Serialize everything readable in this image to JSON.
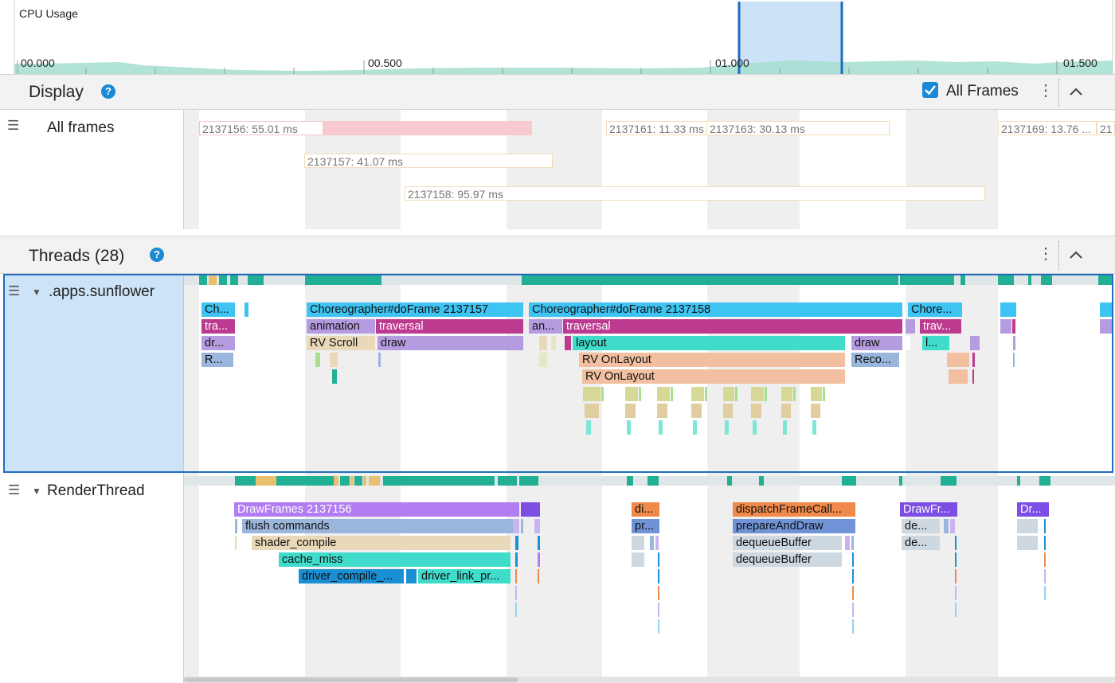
{
  "cpu": {
    "title": "CPU Usage",
    "ticks": [
      "00.000",
      "00.500",
      "01.000",
      "01.500"
    ]
  },
  "display": {
    "title": "Display",
    "help_glyph": "?",
    "all_frames_checked": true,
    "all_frames_label": "All Frames",
    "lane_label": "All frames",
    "frames": [
      {
        "label": "2137156: 55.01 ms",
        "highlight": true
      },
      {
        "label": "2137157: 41.07 ms"
      },
      {
        "label": "2137158: 95.97 ms"
      },
      {
        "label": "2137161: 11.33 ms"
      },
      {
        "label": "2137163: 30.13 ms"
      },
      {
        "label": "2137169: 13.76 ..."
      },
      {
        "label": "21"
      }
    ]
  },
  "threads": {
    "title": "Threads (28)",
    "help_glyph": "?",
    "sunflower": {
      "label": ".apps.sunflower",
      "slices": [
        "Ch...",
        "tra...",
        "dr...",
        "R...",
        "Choreographer#doFrame 2137157",
        "animation",
        "traversal",
        "RV Scroll",
        "draw",
        "Choreographer#doFrame 2137158",
        "an...",
        "traversal",
        "layout",
        "RV OnLayout",
        "RV OnLayout",
        "draw",
        "Reco...",
        "Chore...",
        "trav...",
        "l..."
      ]
    },
    "render": {
      "label": "RenderThread",
      "slices": [
        "DrawFrames 2137156",
        "flush commands",
        "shader_compile",
        "cache_miss",
        "driver_compile_...",
        "driver_link_pr...",
        "di...",
        "pr...",
        "dispatchFrameCall...",
        "prepareAndDraw",
        "dequeueBuffer",
        "dequeueBuffer",
        "DrawFr...",
        "de...",
        "de...",
        "Dr..."
      ]
    }
  },
  "colors": {
    "cpu_area": "#a8e0d2",
    "selection": "#cbe2f7",
    "selection_edge": "#1e6ec0",
    "thread_selected_bg": "#cde3f7",
    "state_running": "#22b094",
    "help_blue": "#1a8ad4"
  },
  "icons": {
    "help": "question-circle-icon",
    "checkbox": "checkbox-checked-icon",
    "kebab": "kebab-menu-icon",
    "collapse": "chevron-up-icon",
    "drag": "drag-handle-icon",
    "expand": "triangle-down-icon"
  }
}
